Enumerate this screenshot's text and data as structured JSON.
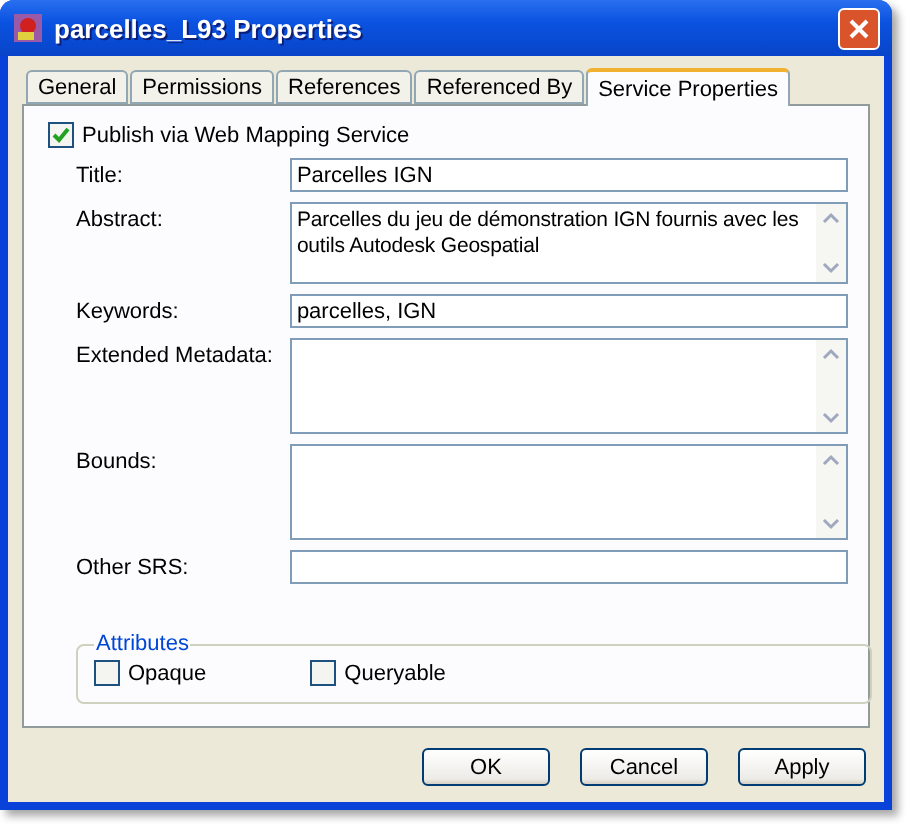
{
  "window": {
    "title": "parcelles_L93 Properties"
  },
  "tabs": [
    {
      "label": "General",
      "selected": false
    },
    {
      "label": "Permissions",
      "selected": false
    },
    {
      "label": "References",
      "selected": false
    },
    {
      "label": "Referenced By",
      "selected": false
    },
    {
      "label": "Service Properties",
      "selected": true
    }
  ],
  "publish": {
    "label": "Publish via Web Mapping Service",
    "checked": true
  },
  "fields": [
    {
      "label": "Title:",
      "kind": "line",
      "value": "Parcelles IGN"
    },
    {
      "label": "Abstract:",
      "kind": "multiline",
      "value": "Parcelles du jeu de démonstration IGN fournis avec les outils Autodesk Geospatial"
    },
    {
      "label": "Keywords:",
      "kind": "line",
      "value": "parcelles, IGN"
    },
    {
      "label": "Extended Metadata:",
      "kind": "tall"
    },
    {
      "label": "Bounds:",
      "kind": "tall"
    },
    {
      "label": "Other SRS:",
      "kind": "line"
    }
  ],
  "attributes": {
    "title": "Attributes",
    "options": [
      {
        "label": "Opaque",
        "checked": false
      },
      {
        "label": "Queryable",
        "checked": false
      }
    ]
  },
  "buttons": [
    "OK",
    "Cancel",
    "Apply"
  ]
}
